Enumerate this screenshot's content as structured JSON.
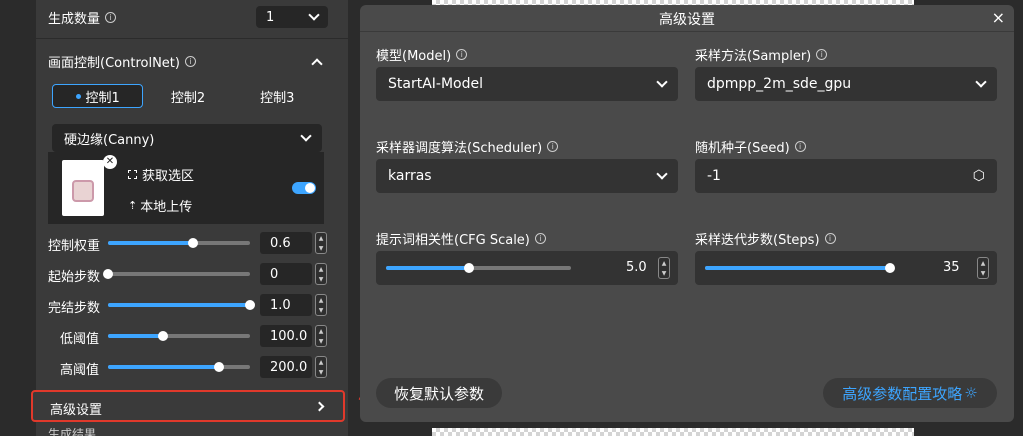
{
  "left": {
    "gen_count_label": "生成数量",
    "gen_count_value": "1",
    "controlnet_title": "画面控制(ControlNet)",
    "tabs": [
      "控制1",
      "控制2",
      "控制3"
    ],
    "preprocessor": "硬边缘(Canny)",
    "get_selection": "获取选区",
    "local_upload": "本地上传",
    "toggle_on": true,
    "params": [
      {
        "label": "控制权重",
        "value": "0.6",
        "level": 0.6
      },
      {
        "label": "起始步数",
        "value": "0",
        "level": 0.0
      },
      {
        "label": "完结步数",
        "value": "1.0",
        "level": 1.0
      },
      {
        "label": "低阈值",
        "value": "100.0",
        "level": 0.39
      },
      {
        "label": "高阈值",
        "value": "200.0",
        "level": 0.78
      }
    ],
    "advanced": "高级设置",
    "bottom_label": "生成结果"
  },
  "modal": {
    "title": "高级设置",
    "close": "×",
    "model_label": "模型(Model)",
    "model_value": "StartAI-Model",
    "sampler_label": "采样方法(Sampler)",
    "sampler_value": "dpmpp_2m_sde_gpu",
    "scheduler_label": "采样器调度算法(Scheduler)",
    "scheduler_value": "karras",
    "seed_label": "随机种子(Seed)",
    "seed_value": "-1",
    "cfg_label": "提示词相关性(CFG Scale)",
    "cfg_value": "5.0",
    "cfg_level": 0.45,
    "steps_label": "采样迭代步数(Steps)",
    "steps_value": "35",
    "steps_level": 1.0,
    "reset": "恢复默认参数",
    "guide": "高级参数配置攻略"
  },
  "colors": {
    "accent": "#3da5ff",
    "highlight": "#e0392b"
  }
}
